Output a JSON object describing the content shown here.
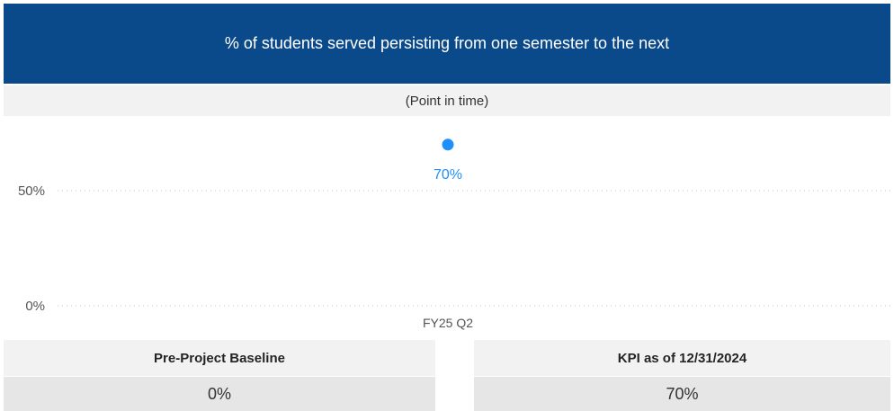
{
  "colors": {
    "header_bg": "#0a4a8a",
    "point": "#1f8ffb",
    "grid": "#c8c8c8",
    "axis_text": "#555555"
  },
  "header": {
    "title": "% of students served persisting from one semester to the next",
    "subtitle": "(Point in time)"
  },
  "chart_data": {
    "type": "scatter",
    "categories": [
      "FY25 Q2"
    ],
    "series": [
      {
        "values": [
          70
        ],
        "labels": [
          "70%"
        ]
      }
    ],
    "y_ticks": [
      0,
      50
    ],
    "y_tick_labels": [
      "0%",
      "50%"
    ],
    "ylim": [
      0,
      75
    ],
    "grid": true,
    "grid_style": "dotted"
  },
  "cards": [
    {
      "label": "Pre-Project Baseline",
      "value": "0%"
    },
    {
      "label": "KPI as of 12/31/2024",
      "value": "70%"
    }
  ]
}
